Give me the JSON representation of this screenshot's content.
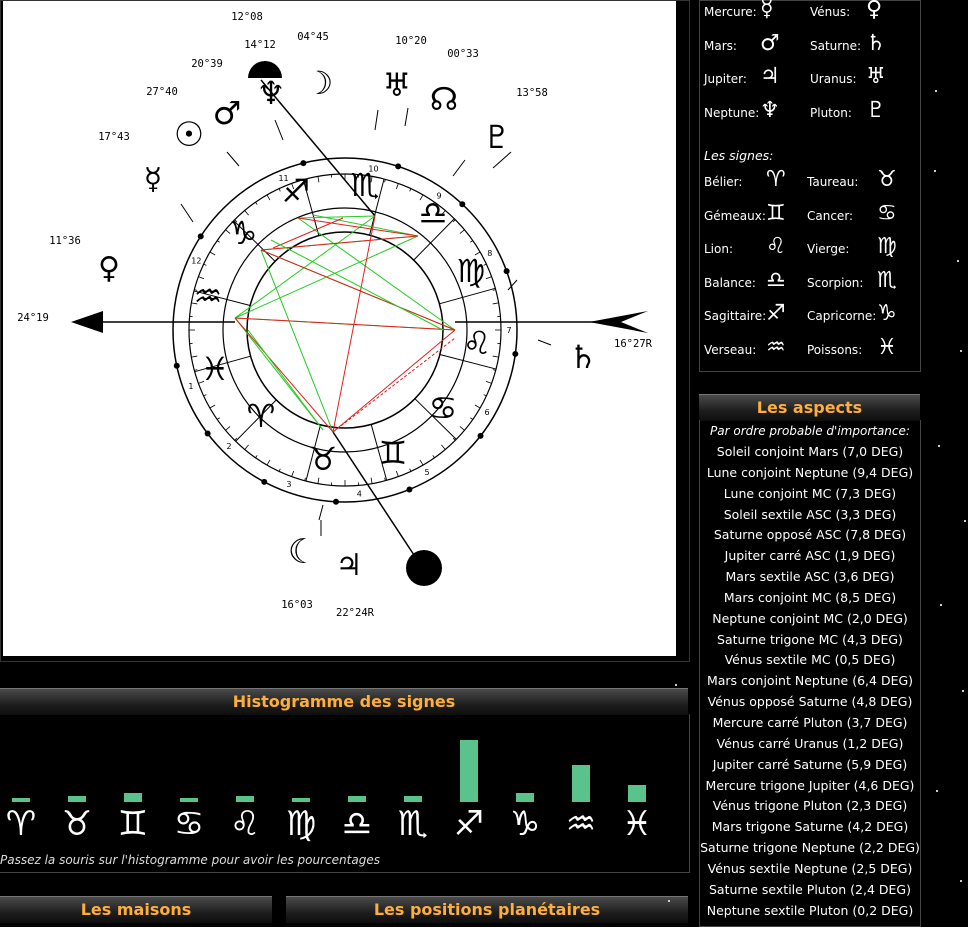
{
  "chart": {
    "degree_labels": [
      {
        "text": "12°08",
        "name": "degree-label-1208"
      },
      {
        "text": "14°12",
        "name": "degree-label-1412"
      },
      {
        "text": "04°45",
        "name": "degree-label-0445"
      },
      {
        "text": "10°20",
        "name": "degree-label-1020"
      },
      {
        "text": "00°33",
        "name": "degree-label-0033"
      },
      {
        "text": "20°39",
        "name": "degree-label-2039"
      },
      {
        "text": "27°40",
        "name": "degree-label-2740"
      },
      {
        "text": "13°58",
        "name": "degree-label-1358"
      },
      {
        "text": "17°43",
        "name": "degree-label-1743"
      },
      {
        "text": "11°36",
        "name": "degree-label-1136"
      },
      {
        "text": "24°19",
        "name": "degree-label-asc"
      },
      {
        "text": "16°27R",
        "name": "degree-label-saturn"
      },
      {
        "text": "16°03",
        "name": "degree-label-1603"
      },
      {
        "text": "22°24R",
        "name": "degree-label-2224"
      }
    ],
    "house_numbers": [
      "1",
      "2",
      "3",
      "4",
      "5",
      "6",
      "7",
      "8",
      "9",
      "10",
      "11",
      "12"
    ]
  },
  "legend": {
    "planets": [
      {
        "label": "Mercure:",
        "glyph": "☿"
      },
      {
        "label": "Vénus:",
        "glyph": "♀"
      },
      {
        "label": "Mars:",
        "glyph": "♂"
      },
      {
        "label": "Saturne:",
        "glyph": "♄"
      },
      {
        "label": "Jupiter:",
        "glyph": "♃"
      },
      {
        "label": "Uranus:",
        "glyph": "♅"
      },
      {
        "label": "Neptune:",
        "glyph": "♆"
      },
      {
        "label": "Pluton:",
        "glyph": "♇"
      }
    ],
    "signs_title": "Les signes:",
    "signs": [
      {
        "label": "Bélier:",
        "glyph": "♈"
      },
      {
        "label": "Taureau:",
        "glyph": "♉"
      },
      {
        "label": "Gémeaux:",
        "glyph": "♊"
      },
      {
        "label": "Cancer:",
        "glyph": "♋"
      },
      {
        "label": "Lion:",
        "glyph": "♌"
      },
      {
        "label": "Vierge:",
        "glyph": "♍"
      },
      {
        "label": "Balance:",
        "glyph": "♎"
      },
      {
        "label": "Scorpion:",
        "glyph": "♏"
      },
      {
        "label": "Sagittaire:",
        "glyph": "♐"
      },
      {
        "label": "Capricorne:",
        "glyph": "♑"
      },
      {
        "label": "Verseau:",
        "glyph": "♒"
      },
      {
        "label": "Poissons:",
        "glyph": "♓"
      }
    ]
  },
  "aspects": {
    "title": "Les aspects",
    "subtitle": "Par ordre probable d'importance:",
    "items": [
      "Soleil conjoint Mars (7,0 DEG)",
      "Lune conjoint Neptune (9,4 DEG)",
      "Lune conjoint MC (7,3 DEG)",
      "Soleil sextile ASC (3,3 DEG)",
      "Saturne opposé ASC (7,8 DEG)",
      "Jupiter carré ASC (1,9 DEG)",
      "Mars sextile ASC (3,6 DEG)",
      "Mars conjoint MC (8,5 DEG)",
      "Neptune conjoint MC (2,0 DEG)",
      "Saturne trigone MC (4,3 DEG)",
      "Vénus sextile MC (0,5 DEG)",
      "Mars conjoint Neptune (6,4 DEG)",
      "Vénus opposé Saturne (4,8 DEG)",
      "Mercure carré Pluton (3,7 DEG)",
      "Vénus carré Uranus (1,2 DEG)",
      "Jupiter carré Saturne (5,9 DEG)",
      "Mercure trigone Jupiter (4,6 DEG)",
      "Vénus trigone Pluton (2,3 DEG)",
      "Mars trigone Saturne (4,2 DEG)",
      "Saturne trigone Neptune (2,2 DEG)",
      "Vénus sextile Neptune (2,5 DEG)",
      "Saturne sextile Pluton (2,4 DEG)",
      "Neptune sextile Pluton (0,2 DEG)"
    ]
  },
  "histogram": {
    "title": "Histogramme des signes",
    "hint": "Passez la souris sur l'histogramme pour avoir les pourcentages",
    "signs": [
      {
        "glyph": "♈",
        "name": "Bélier",
        "level": 0.07
      },
      {
        "glyph": "♉",
        "name": "Taureau",
        "level": 0.1
      },
      {
        "glyph": "♊",
        "name": "Gémeaux",
        "level": 0.15
      },
      {
        "glyph": "♋",
        "name": "Cancer",
        "level": 0.07
      },
      {
        "glyph": "♌",
        "name": "Lion",
        "level": 0.1
      },
      {
        "glyph": "♍",
        "name": "Vierge",
        "level": 0.07
      },
      {
        "glyph": "♎",
        "name": "Balance",
        "level": 0.1
      },
      {
        "glyph": "♏",
        "name": "Scorpion",
        "level": 0.1
      },
      {
        "glyph": "♐",
        "name": "Sagittaire",
        "level": 1.0
      },
      {
        "glyph": "♑",
        "name": "Capricorne",
        "level": 0.15
      },
      {
        "glyph": "♒",
        "name": "Verseau",
        "level": 0.6
      },
      {
        "glyph": "♓",
        "name": "Poissons",
        "level": 0.27
      }
    ],
    "color": "#5ac38c"
  },
  "bottom_tabs": {
    "houses": "Les maisons",
    "positions": "Les positions planétaires"
  },
  "colors": {
    "accent": "#ffae3c",
    "aspect_green": "#22cc22",
    "aspect_red": "#e02020"
  }
}
